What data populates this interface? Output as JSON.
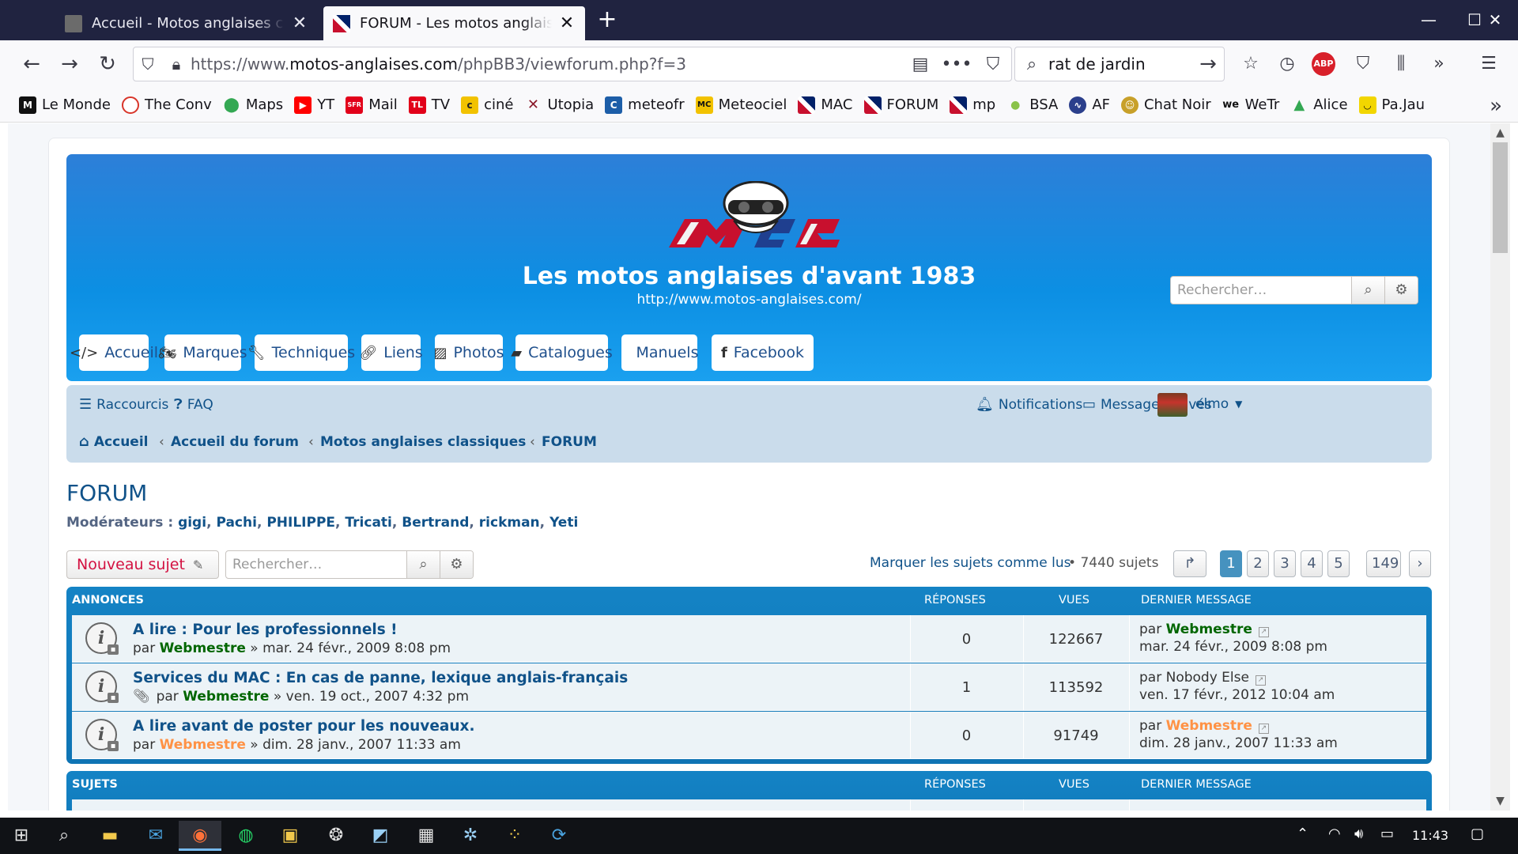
{
  "browser": {
    "tabs": [
      {
        "title": "Accueil - Motos anglaises classiques",
        "active": false
      },
      {
        "title": "FORUM - Les motos anglaises d'avant 1983",
        "active": true
      }
    ],
    "new_tab_label": "+",
    "url_prefix": "https://www.",
    "url_domain": "motos-anglaises.com",
    "url_path": "/phpBB3/viewforum.php?f=3",
    "search_query": "rat de jardin",
    "bookmarks": [
      {
        "label": "Le Monde",
        "icon": "M",
        "color": "#111111"
      },
      {
        "label": "The Conv",
        "icon": "○",
        "color": "#d8352a"
      },
      {
        "label": "Maps",
        "icon": "●",
        "color": "#34a853"
      },
      {
        "label": "YT",
        "icon": "▶",
        "color": "#ff0000"
      },
      {
        "label": "Mail",
        "icon": "SFR",
        "color": "#e2001a"
      },
      {
        "label": "TV",
        "icon": "TL",
        "color": "#e2001a"
      },
      {
        "label": "ciné",
        "icon": "c",
        "color": "#f2c200"
      },
      {
        "label": "Utopia",
        "icon": "✕",
        "color": "#8b1a2a"
      },
      {
        "label": "meteofr",
        "icon": "C",
        "color": "#1d5ea8"
      },
      {
        "label": "Meteociel",
        "icon": "MC",
        "color": "#f2c200"
      },
      {
        "label": "MAC",
        "icon": "✱",
        "color": "#2b3f8c"
      },
      {
        "label": "FORUM",
        "icon": "✱",
        "color": "#2b3f8c"
      },
      {
        "label": "mp",
        "icon": "✱",
        "color": "#2b3f8c"
      },
      {
        "label": "BSA",
        "icon": "●",
        "color": "#8bc34a"
      },
      {
        "label": "AF",
        "icon": "∿",
        "color": "#2b3f8c"
      },
      {
        "label": "Chat Noir",
        "icon": "☺",
        "color": "#c8a02a"
      },
      {
        "label": "WeTr",
        "icon": "we",
        "color": "#111111"
      },
      {
        "label": "Alice",
        "icon": "▲",
        "color": "#34a853"
      },
      {
        "label": "Pa.Jau",
        "icon": "◡",
        "color": "#f2d600"
      }
    ]
  },
  "site": {
    "title": "Les motos anglaises d'avant 1983",
    "url": "http://www.motos-anglaises.com/",
    "search_placeholder": "Rechercher…",
    "nav": [
      "Accueil",
      "Marques",
      "Techniques",
      "Liens",
      "Photos",
      "Catalogues",
      "Manuels",
      "Facebook"
    ]
  },
  "navbar": {
    "shortcuts": "Raccourcis",
    "faq": "FAQ",
    "notifications": "Notifications",
    "messages": "Messages privés",
    "username": "elmo",
    "breadcrumbs": [
      "Accueil",
      "Accueil du forum",
      "Motos anglaises classiques",
      "FORUM"
    ]
  },
  "forum": {
    "title": "FORUM",
    "moderators_label": "Modérateurs :",
    "moderators": [
      "gigi",
      "Pachi",
      "PHILIPPE",
      "Tricati",
      "Bertrand",
      "rickman",
      "Yeti"
    ],
    "new_topic": "Nouveau sujet",
    "search_placeholder": "Rechercher…",
    "mark_read": "Marquer les sujets comme lus",
    "topic_count": "7440 sujets",
    "pages": [
      "1",
      "2",
      "3",
      "4",
      "5"
    ],
    "ellipsis": "…",
    "last_page": "149",
    "columns": {
      "replies": "RÉPONSES",
      "views": "VUES",
      "last_post": "DERNIER MESSAGE"
    },
    "announcements_label": "ANNONCES",
    "topics_label": "SUJETS",
    "announcements": [
      {
        "title": "A lire : Pour les professionnels !",
        "by": "par",
        "author": "Webmestre",
        "date": "» mar. 24 févr., 2009 8:08 pm",
        "replies": "0",
        "views": "122667",
        "last_by": "par",
        "last_author": "Webmestre",
        "last_date": "mar. 24 févr., 2009 8:08 pm",
        "attachment": false
      },
      {
        "title": "Services du MAC : En cas de panne, lexique anglais-français",
        "by": "par",
        "author": "Webmestre",
        "date": "» ven. 19 oct., 2007 4:32 pm",
        "replies": "1",
        "views": "113592",
        "last_by": "par",
        "last_author": "Nobody Else",
        "last_date": "ven. 17 févr., 2012 10:04 am",
        "attachment": true
      },
      {
        "title": "A lire avant de poster pour les nouveaux.",
        "by": "par",
        "author": "Webmestre",
        "date": "» dim. 28 janv., 2007 11:33 am",
        "replies": "0",
        "views": "91749",
        "last_by": "par",
        "last_author": "Webmestre",
        "last_date": "dim. 28 janv., 2007 11:33 am",
        "attachment": false
      }
    ]
  },
  "taskbar": {
    "time": "11:43"
  }
}
